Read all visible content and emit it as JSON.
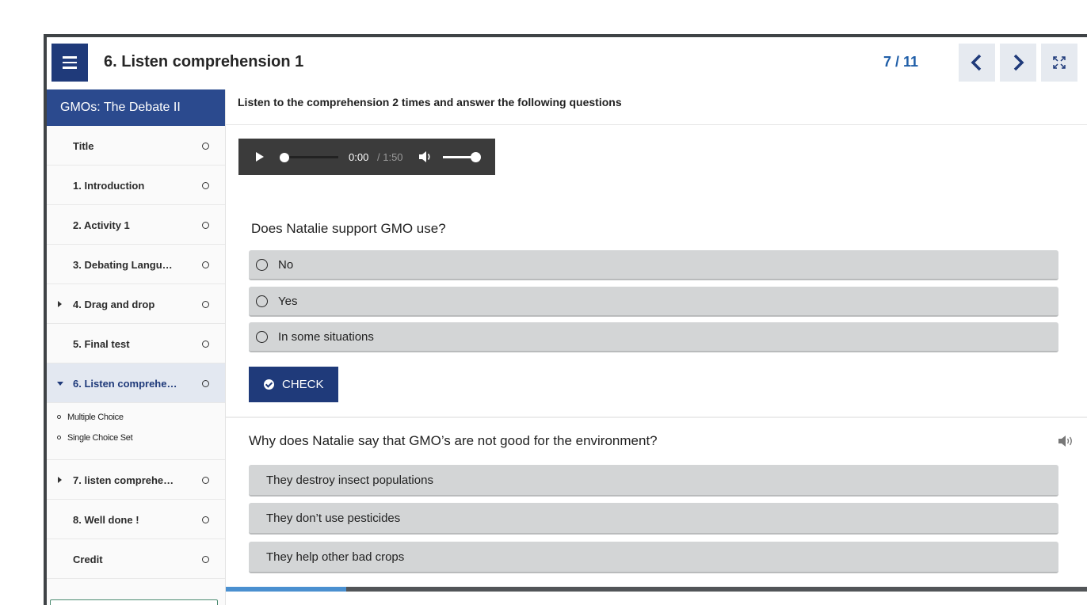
{
  "header": {
    "title": "6. Listen comprehension 1",
    "progress": "7 / 11"
  },
  "sidebar": {
    "course_title": "GMOs: The Debate II",
    "items": [
      {
        "label": "Title",
        "expandable": false
      },
      {
        "label": "1. Introduction",
        "expandable": false
      },
      {
        "label": "2. Activity 1",
        "expandable": false
      },
      {
        "label": "3. Debating Langu…",
        "expandable": false
      },
      {
        "label": "4. Drag and drop",
        "expandable": true
      },
      {
        "label": "5. Final test",
        "expandable": false
      },
      {
        "label": "6. Listen comprehe…",
        "expandable": true,
        "active": true
      },
      {
        "label": "7. listen comprehe…",
        "expandable": true
      },
      {
        "label": "8. Well done !",
        "expandable": false
      },
      {
        "label": "Credit",
        "expandable": false
      }
    ],
    "subitems": [
      "Multiple Choice",
      "Single Choice Set"
    ]
  },
  "main": {
    "instruction": "Listen to the comprehension 2 times and answer the following questions",
    "audio": {
      "current_time": "0:00",
      "total_time": "/ 1:50",
      "seek_fraction": 0.0,
      "volume_fraction": 1.0
    },
    "question1": {
      "text": "Does Natalie support GMO use?",
      "choices": [
        "No",
        "Yes",
        "In some situations"
      ]
    },
    "check_label": "CHECK",
    "question2": {
      "text": "Why does Natalie say that GMO’s are not good for the environment?",
      "answers": [
        "They destroy insect populations",
        "They don’t use pesticides",
        "They help other bad crops"
      ]
    },
    "slide_progress_fraction": 0.14
  },
  "colors": {
    "primary": "#1f3a7a",
    "progress_text": "#1f5ea8",
    "choice_bg": "#d3d5d6",
    "audio_bg": "#3b3b3b",
    "bottom_progress": "#4a90d0"
  },
  "icons": {
    "menu": "hamburger-icon",
    "prev": "chevron-left-icon",
    "next": "chevron-right-icon",
    "fullscreen": "expand-icon",
    "play": "play-icon",
    "volume": "volume-icon",
    "check": "check-circle-icon",
    "speaker": "speaker-icon"
  }
}
